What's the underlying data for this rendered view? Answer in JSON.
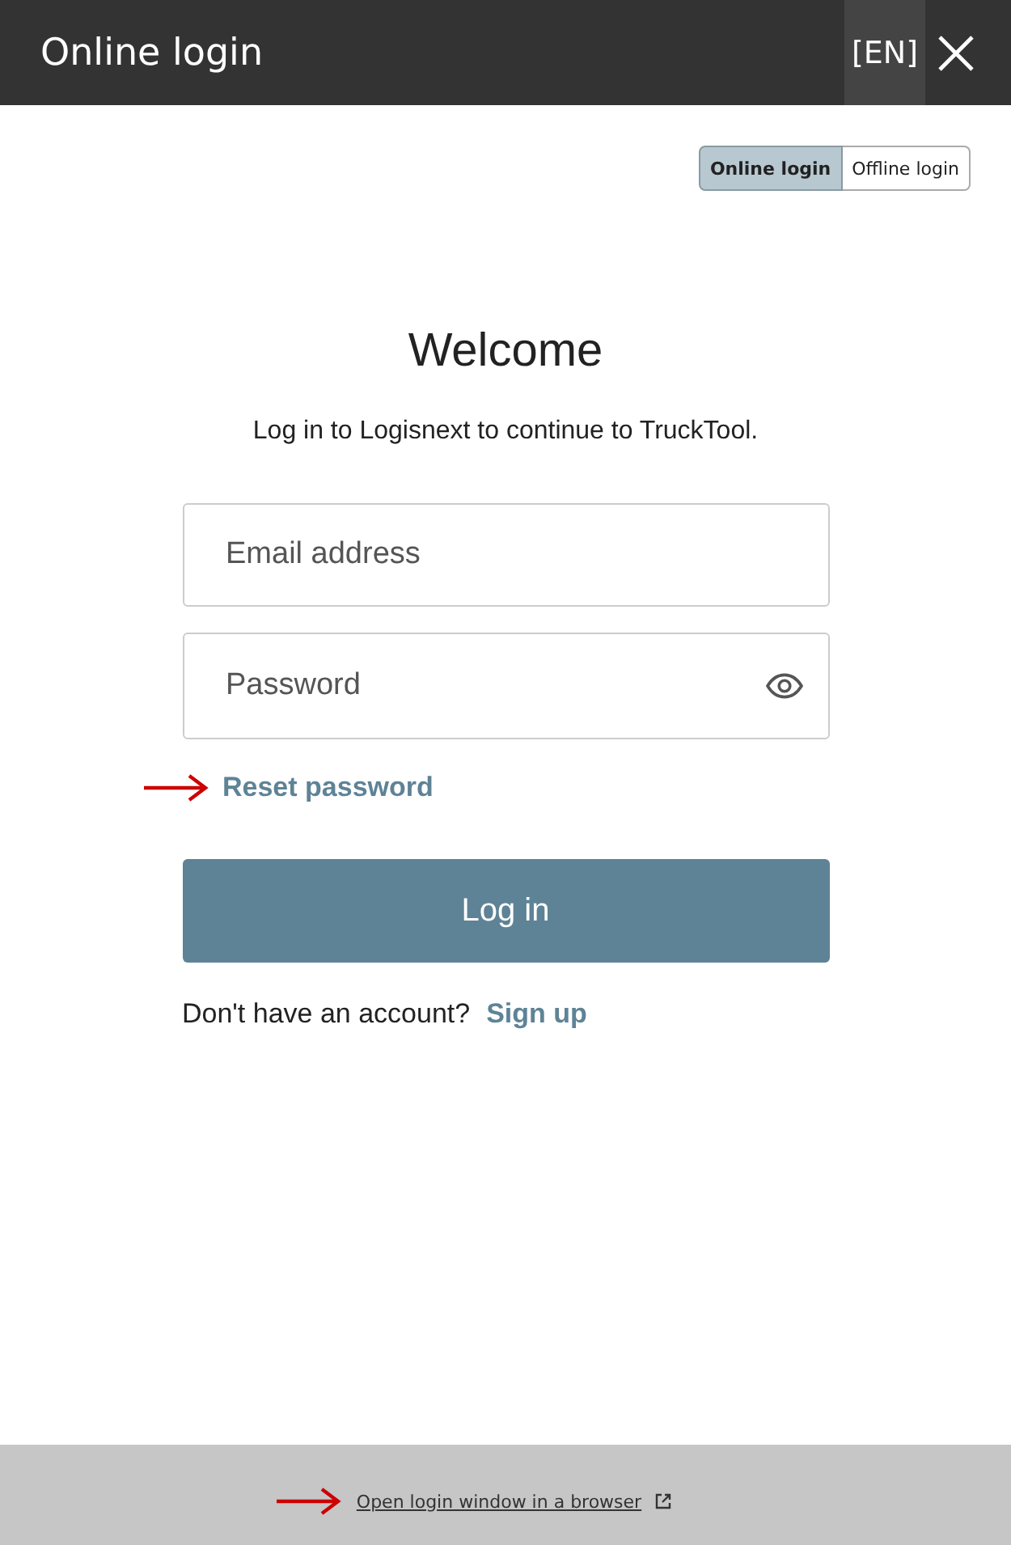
{
  "window": {
    "title": "Online login",
    "language": "[EN]"
  },
  "mode_toggle": [
    {
      "label": "Online login",
      "selected": true
    },
    {
      "label": "Offline login",
      "selected": false
    }
  ],
  "heading": "Welcome",
  "subtitle": "Log in to Logisnext to continue to TruckTool.",
  "email": {
    "placeholder": "Email address"
  },
  "password": {
    "placeholder": "Password"
  },
  "reset_link": "Reset password",
  "login_button": "Log in",
  "signup": {
    "prompt": "Don't have an account?",
    "link": "Sign up"
  },
  "footer": {
    "link": "Open login window in a browser"
  }
}
